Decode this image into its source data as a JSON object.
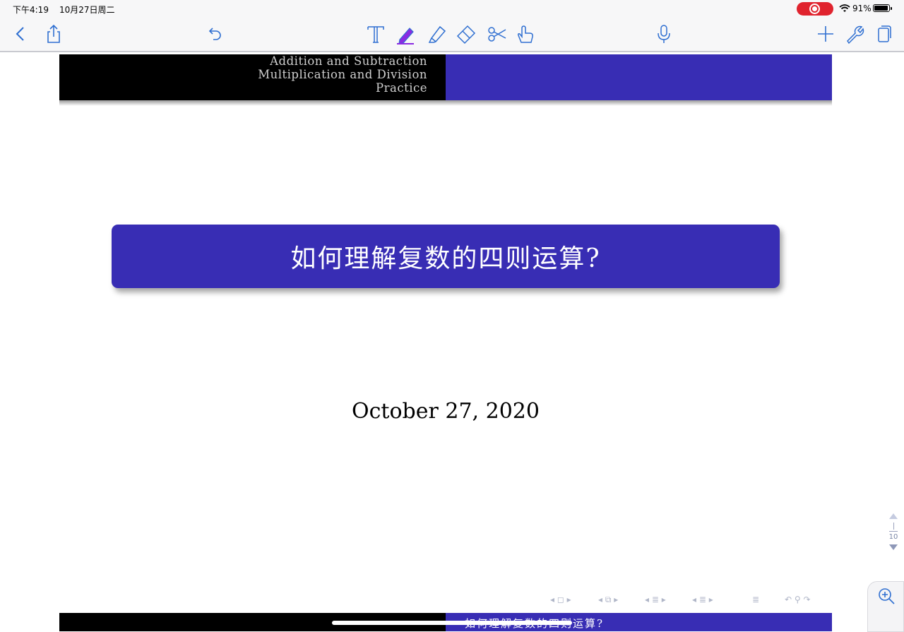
{
  "status_bar": {
    "time": "下午4:19",
    "date": "10月27日周二",
    "battery": "91%"
  },
  "toolbar": {
    "left_icons": [
      "back-icon",
      "share-icon",
      "undo-icon"
    ],
    "tools": [
      "text-tool-icon",
      "pen-tool-icon",
      "highlighter-tool-icon",
      "eraser-tool-icon",
      "lasso-scissors-icon",
      "pointer-hand-icon"
    ],
    "center_icon": "microphone-icon",
    "right_icons": [
      "add-icon",
      "wrench-icon",
      "pages-icon"
    ],
    "accent_color": "#2f6fd1",
    "pen_color": "#8a2be2"
  },
  "slide": {
    "header_lines": [
      "Addition and Subtraction",
      "Multiplication and Division",
      "Practice"
    ],
    "title": "如何理解复数的四则运算?",
    "date": "October 27, 2020",
    "footer_title": "如何理解复数的四则运算?",
    "theme_color": "#382db4"
  },
  "page_indicator": {
    "current": "1",
    "total": "10"
  }
}
